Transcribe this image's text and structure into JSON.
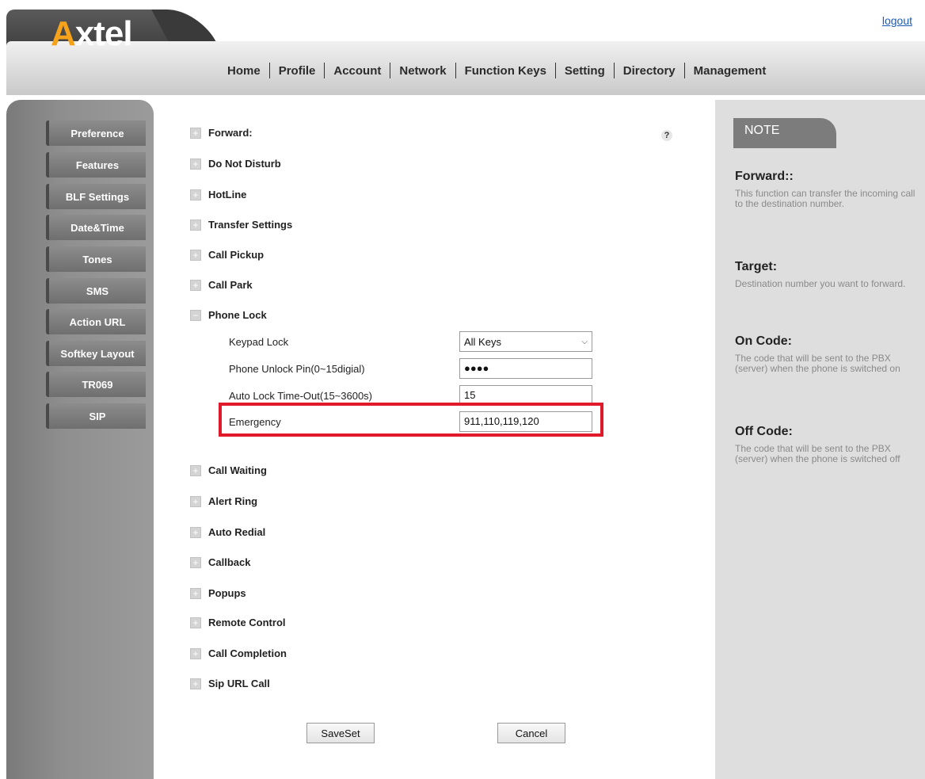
{
  "header": {
    "logo_text_a": "A",
    "logo_text_rest": "xtel",
    "logout_label": "logout",
    "nav": [
      "Home",
      "Profile",
      "Account",
      "Network",
      "Function Keys",
      "Setting",
      "Directory",
      "Management"
    ],
    "active_nav": "Setting"
  },
  "sidebar": {
    "items": [
      "Preference",
      "Features",
      "BLF Settings",
      "Date&Time",
      "Tones",
      "SMS",
      "Action URL",
      "Softkey Layout",
      "TR069",
      "SIP"
    ]
  },
  "main": {
    "help_icon": "?",
    "sections_top": [
      "Forward:",
      "Do Not Disturb",
      "HotLine",
      "Transfer Settings",
      "Call Pickup",
      "Call Park",
      "Phone Lock"
    ],
    "phone_lock": {
      "keypad_lock_label": "Keypad Lock",
      "keypad_lock_value": "All Keys",
      "unlock_pin_label": "Phone Unlock Pin(0~15digial)",
      "unlock_pin_value": "●●●●",
      "auto_lock_label": "Auto Lock Time-Out(15~3600s)",
      "auto_lock_value": "15",
      "emergency_label": "Emergency",
      "emergency_value": "911,110,119,120"
    },
    "sections_bottom": [
      "Call Waiting",
      "Alert Ring",
      "Auto Redial",
      "Callback",
      "Popups",
      "Remote Control",
      "Call Completion",
      "Sip URL Call"
    ],
    "save_label": "SaveSet",
    "cancel_label": "Cancel"
  },
  "note": {
    "tab_label": "NOTE",
    "entries": [
      {
        "title": "Forward::",
        "body": "This function can transfer the incoming call to the destination number."
      },
      {
        "title": "Target:",
        "body": "Destination number you want to forward."
      },
      {
        "title": "On Code:",
        "body": "The code that will be sent to the PBX (server) when the phone is switched on"
      },
      {
        "title": "Off Code:",
        "body": "The code that will be sent to the PBX (server) when the phone is switched off"
      }
    ]
  },
  "colors": {
    "highlight_border": "#e0192b",
    "logo_accent": "#f7a21b",
    "link": "#1d5bb5"
  }
}
